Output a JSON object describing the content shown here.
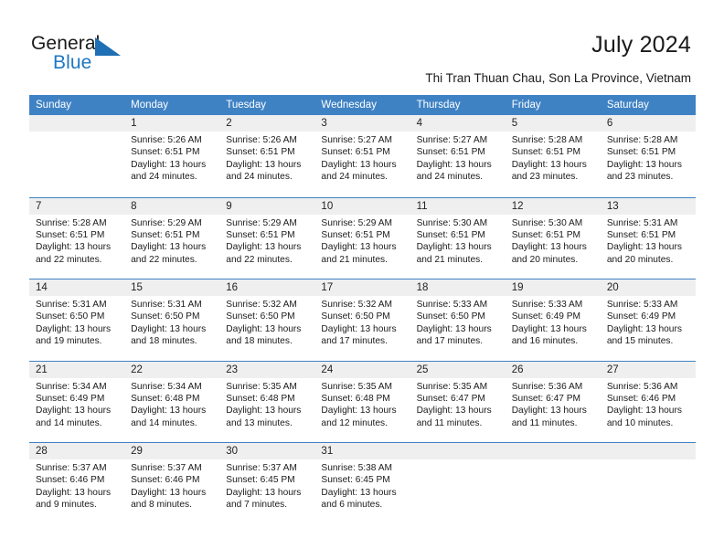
{
  "brand": {
    "name_dark": "General",
    "name_blue": "Blue",
    "accent_color": "#1f6fb5"
  },
  "header": {
    "title": "July 2024",
    "subtitle": "Thi Tran Thuan Chau, Son La Province, Vietnam"
  },
  "calendar": {
    "header_bg": "#3f82c4",
    "daynum_band_bg": "#efefef",
    "weekday_headers": [
      "Sunday",
      "Monday",
      "Tuesday",
      "Wednesday",
      "Thursday",
      "Friday",
      "Saturday"
    ],
    "weeks": [
      [
        {
          "day": "",
          "sunrise": "",
          "sunset": "",
          "daylight_line1": "",
          "daylight_line2": ""
        },
        {
          "day": "1",
          "sunrise": "Sunrise: 5:26 AM",
          "sunset": "Sunset: 6:51 PM",
          "daylight_line1": "Daylight: 13 hours",
          "daylight_line2": "and 24 minutes."
        },
        {
          "day": "2",
          "sunrise": "Sunrise: 5:26 AM",
          "sunset": "Sunset: 6:51 PM",
          "daylight_line1": "Daylight: 13 hours",
          "daylight_line2": "and 24 minutes."
        },
        {
          "day": "3",
          "sunrise": "Sunrise: 5:27 AM",
          "sunset": "Sunset: 6:51 PM",
          "daylight_line1": "Daylight: 13 hours",
          "daylight_line2": "and 24 minutes."
        },
        {
          "day": "4",
          "sunrise": "Sunrise: 5:27 AM",
          "sunset": "Sunset: 6:51 PM",
          "daylight_line1": "Daylight: 13 hours",
          "daylight_line2": "and 24 minutes."
        },
        {
          "day": "5",
          "sunrise": "Sunrise: 5:28 AM",
          "sunset": "Sunset: 6:51 PM",
          "daylight_line1": "Daylight: 13 hours",
          "daylight_line2": "and 23 minutes."
        },
        {
          "day": "6",
          "sunrise": "Sunrise: 5:28 AM",
          "sunset": "Sunset: 6:51 PM",
          "daylight_line1": "Daylight: 13 hours",
          "daylight_line2": "and 23 minutes."
        }
      ],
      [
        {
          "day": "7",
          "sunrise": "Sunrise: 5:28 AM",
          "sunset": "Sunset: 6:51 PM",
          "daylight_line1": "Daylight: 13 hours",
          "daylight_line2": "and 22 minutes."
        },
        {
          "day": "8",
          "sunrise": "Sunrise: 5:29 AM",
          "sunset": "Sunset: 6:51 PM",
          "daylight_line1": "Daylight: 13 hours",
          "daylight_line2": "and 22 minutes."
        },
        {
          "day": "9",
          "sunrise": "Sunrise: 5:29 AM",
          "sunset": "Sunset: 6:51 PM",
          "daylight_line1": "Daylight: 13 hours",
          "daylight_line2": "and 22 minutes."
        },
        {
          "day": "10",
          "sunrise": "Sunrise: 5:29 AM",
          "sunset": "Sunset: 6:51 PM",
          "daylight_line1": "Daylight: 13 hours",
          "daylight_line2": "and 21 minutes."
        },
        {
          "day": "11",
          "sunrise": "Sunrise: 5:30 AM",
          "sunset": "Sunset: 6:51 PM",
          "daylight_line1": "Daylight: 13 hours",
          "daylight_line2": "and 21 minutes."
        },
        {
          "day": "12",
          "sunrise": "Sunrise: 5:30 AM",
          "sunset": "Sunset: 6:51 PM",
          "daylight_line1": "Daylight: 13 hours",
          "daylight_line2": "and 20 minutes."
        },
        {
          "day": "13",
          "sunrise": "Sunrise: 5:31 AM",
          "sunset": "Sunset: 6:51 PM",
          "daylight_line1": "Daylight: 13 hours",
          "daylight_line2": "and 20 minutes."
        }
      ],
      [
        {
          "day": "14",
          "sunrise": "Sunrise: 5:31 AM",
          "sunset": "Sunset: 6:50 PM",
          "daylight_line1": "Daylight: 13 hours",
          "daylight_line2": "and 19 minutes."
        },
        {
          "day": "15",
          "sunrise": "Sunrise: 5:31 AM",
          "sunset": "Sunset: 6:50 PM",
          "daylight_line1": "Daylight: 13 hours",
          "daylight_line2": "and 18 minutes."
        },
        {
          "day": "16",
          "sunrise": "Sunrise: 5:32 AM",
          "sunset": "Sunset: 6:50 PM",
          "daylight_line1": "Daylight: 13 hours",
          "daylight_line2": "and 18 minutes."
        },
        {
          "day": "17",
          "sunrise": "Sunrise: 5:32 AM",
          "sunset": "Sunset: 6:50 PM",
          "daylight_line1": "Daylight: 13 hours",
          "daylight_line2": "and 17 minutes."
        },
        {
          "day": "18",
          "sunrise": "Sunrise: 5:33 AM",
          "sunset": "Sunset: 6:50 PM",
          "daylight_line1": "Daylight: 13 hours",
          "daylight_line2": "and 17 minutes."
        },
        {
          "day": "19",
          "sunrise": "Sunrise: 5:33 AM",
          "sunset": "Sunset: 6:49 PM",
          "daylight_line1": "Daylight: 13 hours",
          "daylight_line2": "and 16 minutes."
        },
        {
          "day": "20",
          "sunrise": "Sunrise: 5:33 AM",
          "sunset": "Sunset: 6:49 PM",
          "daylight_line1": "Daylight: 13 hours",
          "daylight_line2": "and 15 minutes."
        }
      ],
      [
        {
          "day": "21",
          "sunrise": "Sunrise: 5:34 AM",
          "sunset": "Sunset: 6:49 PM",
          "daylight_line1": "Daylight: 13 hours",
          "daylight_line2": "and 14 minutes."
        },
        {
          "day": "22",
          "sunrise": "Sunrise: 5:34 AM",
          "sunset": "Sunset: 6:48 PM",
          "daylight_line1": "Daylight: 13 hours",
          "daylight_line2": "and 14 minutes."
        },
        {
          "day": "23",
          "sunrise": "Sunrise: 5:35 AM",
          "sunset": "Sunset: 6:48 PM",
          "daylight_line1": "Daylight: 13 hours",
          "daylight_line2": "and 13 minutes."
        },
        {
          "day": "24",
          "sunrise": "Sunrise: 5:35 AM",
          "sunset": "Sunset: 6:48 PM",
          "daylight_line1": "Daylight: 13 hours",
          "daylight_line2": "and 12 minutes."
        },
        {
          "day": "25",
          "sunrise": "Sunrise: 5:35 AM",
          "sunset": "Sunset: 6:47 PM",
          "daylight_line1": "Daylight: 13 hours",
          "daylight_line2": "and 11 minutes."
        },
        {
          "day": "26",
          "sunrise": "Sunrise: 5:36 AM",
          "sunset": "Sunset: 6:47 PM",
          "daylight_line1": "Daylight: 13 hours",
          "daylight_line2": "and 11 minutes."
        },
        {
          "day": "27",
          "sunrise": "Sunrise: 5:36 AM",
          "sunset": "Sunset: 6:46 PM",
          "daylight_line1": "Daylight: 13 hours",
          "daylight_line2": "and 10 minutes."
        }
      ],
      [
        {
          "day": "28",
          "sunrise": "Sunrise: 5:37 AM",
          "sunset": "Sunset: 6:46 PM",
          "daylight_line1": "Daylight: 13 hours",
          "daylight_line2": "and 9 minutes."
        },
        {
          "day": "29",
          "sunrise": "Sunrise: 5:37 AM",
          "sunset": "Sunset: 6:46 PM",
          "daylight_line1": "Daylight: 13 hours",
          "daylight_line2": "and 8 minutes."
        },
        {
          "day": "30",
          "sunrise": "Sunrise: 5:37 AM",
          "sunset": "Sunset: 6:45 PM",
          "daylight_line1": "Daylight: 13 hours",
          "daylight_line2": "and 7 minutes."
        },
        {
          "day": "31",
          "sunrise": "Sunrise: 5:38 AM",
          "sunset": "Sunset: 6:45 PM",
          "daylight_line1": "Daylight: 13 hours",
          "daylight_line2": "and 6 minutes."
        },
        {
          "day": "",
          "sunrise": "",
          "sunset": "",
          "daylight_line1": "",
          "daylight_line2": ""
        },
        {
          "day": "",
          "sunrise": "",
          "sunset": "",
          "daylight_line1": "",
          "daylight_line2": ""
        },
        {
          "day": "",
          "sunrise": "",
          "sunset": "",
          "daylight_line1": "",
          "daylight_line2": ""
        }
      ]
    ]
  }
}
